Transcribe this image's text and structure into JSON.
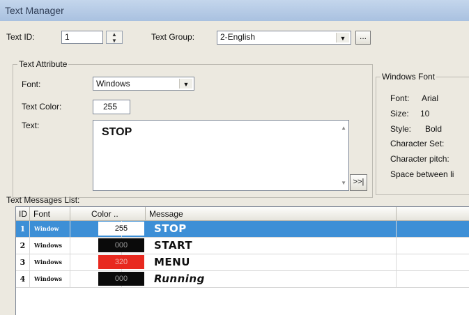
{
  "window": {
    "title": "Text Manager"
  },
  "form": {
    "text_id_label": "Text ID:",
    "text_id_value": "1",
    "text_group_label": "Text Group:",
    "text_group_value": "2-English",
    "group_browse_label": "..."
  },
  "attribute": {
    "title": "Text Attribute",
    "font_label": "Font:",
    "font_value": "Windows",
    "color_label": "Text Color:",
    "color_value": "255",
    "text_label": "Text:",
    "text_value": "STOP",
    "expand_label": ">>|"
  },
  "windows_font": {
    "title": "Windows Font",
    "font_label": "Font:",
    "font_value": "Arial",
    "size_label": "Size:",
    "size_value": "10",
    "style_label": "Style:",
    "style_value": "Bold",
    "charset_label": "Character Set:",
    "pitch_label": "Character pitch:",
    "spacing_label": "Space between li"
  },
  "messages": {
    "title": "Text Messages List:",
    "columns": {
      "id": "ID",
      "font": "Font",
      "color": "Color ..",
      "message": "Message"
    },
    "rows": [
      {
        "id": "1",
        "font": "Window",
        "color": "255",
        "color_hex": "#ffffff",
        "color_text_hex": "#000000",
        "message": "STOP",
        "selected": true,
        "italic": false
      },
      {
        "id": "2",
        "font": "Windows",
        "color": "000",
        "color_hex": "#0a0a0a",
        "color_text_hex": "#9a9a9a",
        "message": "START",
        "selected": false,
        "italic": false
      },
      {
        "id": "3",
        "font": "Windows",
        "color": "320",
        "color_hex": "#e8291f",
        "color_text_hex": "#f2b4ae",
        "message": "MENU",
        "selected": false,
        "italic": false
      },
      {
        "id": "4",
        "font": "Windows",
        "color": "000",
        "color_hex": "#0a0a0a",
        "color_text_hex": "#9a9a9a",
        "message": "Running",
        "selected": false,
        "italic": true
      }
    ]
  }
}
